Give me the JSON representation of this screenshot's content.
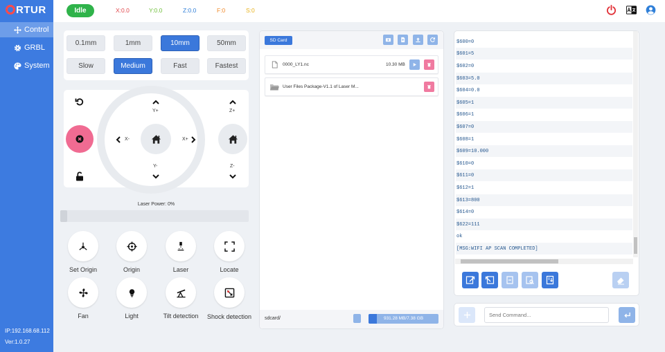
{
  "brand": {
    "logo_text": "RTUR"
  },
  "sidebar": {
    "items": [
      {
        "label": "Control",
        "icon": "move-icon"
      },
      {
        "label": "GRBL",
        "icon": "gear-icon"
      },
      {
        "label": "System",
        "icon": "palette-icon"
      }
    ],
    "ip": "IP:192.168.68.112",
    "version": "Ver:1.0.27"
  },
  "header": {
    "state": "Idle",
    "x": "X:0.0",
    "y": "Y:0.0",
    "z": "Z:0.0",
    "f": "F:0",
    "s": "S:0",
    "colors": {
      "x": "#e0454a",
      "y": "#6fbf3a",
      "z": "#2f7fd8",
      "f": "#f08a2a",
      "s": "#e8b21c"
    }
  },
  "control": {
    "steps": [
      "0.1mm",
      "1mm",
      "10mm",
      "50mm"
    ],
    "selected_step": "10mm",
    "speeds": [
      "Slow",
      "Medium",
      "Fast",
      "Fastest"
    ],
    "selected_speed": "Medium",
    "jog": {
      "y_plus": "Y+",
      "y_minus": "Y-",
      "x_minus": "X-",
      "x_plus": "X+",
      "z_plus": "Z+",
      "z_minus": "Z-"
    },
    "laser_power_label": "Laser Power: 0%",
    "laser_power": 0,
    "tools": [
      "Set Origin",
      "Origin",
      "Laser",
      "Locate",
      "Fan",
      "Light",
      "Tilt detection",
      "Shock detection"
    ]
  },
  "files": {
    "tab": "SD Card",
    "items": [
      {
        "name": "0000_LY1.nc",
        "size": "10.30 MB"
      },
      {
        "name": "User Files Package-V1.1 of Laser M...",
        "size": ""
      }
    ],
    "path": "sdcard/",
    "storage": "931.28 MB/7.38 GB"
  },
  "console": {
    "lines": [
      "$600=0",
      "$601=5",
      "$602=0",
      "$603=5.0",
      "$604=0.0",
      "$605=1",
      "$606=1",
      "$607=0",
      "$608=1",
      "$609=10.000",
      "$610=0",
      "$611=0",
      "$612=1",
      "$613=800",
      "$614=0",
      "$622=111",
      "ok",
      "[MSG:WIFI AP SCAN COMPLETED]"
    ],
    "placeholder": "Send Command..."
  }
}
